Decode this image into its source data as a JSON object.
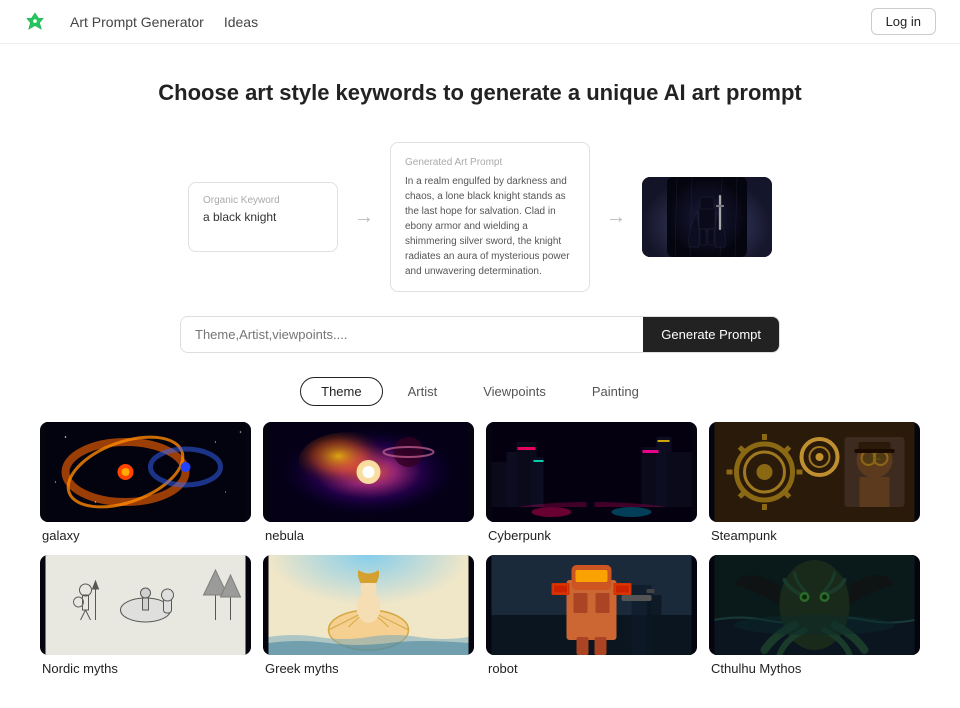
{
  "nav": {
    "logo_text": "",
    "links": [
      {
        "label": "Art Prompt Generator",
        "id": "art-prompt-generator"
      },
      {
        "label": "Ideas",
        "id": "ideas"
      }
    ],
    "login_label": "Log in"
  },
  "hero": {
    "title": "Choose art style keywords to generate a unique AI art prompt"
  },
  "demo": {
    "organic_label": "Organic Keyword",
    "organic_value": "a black knight",
    "generated_label": "Generated Art Prompt",
    "generated_text": "In a realm engulfed by darkness and chaos, a lone black knight stands as the last hope for salvation. Clad in ebony armor and wielding a shimmering silver sword, the knight radiates an aura of mysterious power and unwavering determination."
  },
  "input": {
    "placeholder": "Theme,Artist,viewpoints....",
    "button_label": "Generate Prompt"
  },
  "tabs": [
    {
      "label": "Theme",
      "active": true
    },
    {
      "label": "Artist",
      "active": false
    },
    {
      "label": "Viewpoints",
      "active": false
    },
    {
      "label": "Painting",
      "active": false
    }
  ],
  "grid": [
    {
      "label": "galaxy",
      "thumb_class": "thumb-galaxy-bg"
    },
    {
      "label": "nebula",
      "thumb_class": "thumb-nebula"
    },
    {
      "label": "Cyberpunk",
      "thumb_class": "thumb-cyberpunk"
    },
    {
      "label": "Steampunk",
      "thumb_class": "thumb-steampunk"
    },
    {
      "label": "Nordic myths",
      "thumb_class": "thumb-nordic"
    },
    {
      "label": "Greek myths",
      "thumb_class": "thumb-greek"
    },
    {
      "label": "robot",
      "thumb_class": "thumb-robot"
    },
    {
      "label": "Cthulhu Mythos",
      "thumb_class": "thumb-cthulhu"
    }
  ]
}
